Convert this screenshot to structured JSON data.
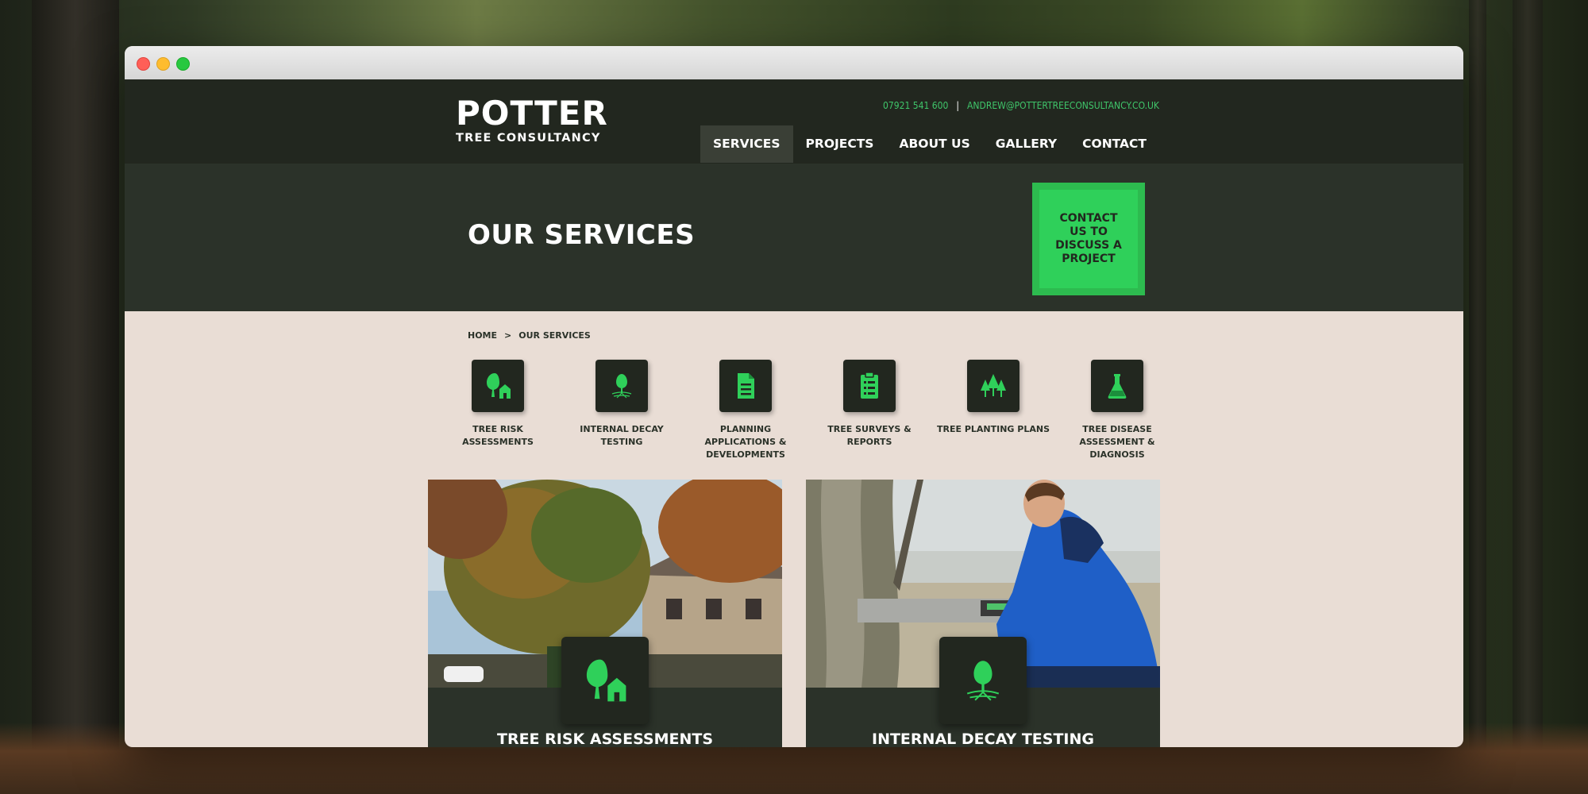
{
  "header": {
    "logo_main": "POTTER",
    "logo_sub": "TREE CONSULTANCY",
    "phone": "07921 541 600",
    "separator": "|",
    "email": "ANDREW@POTTERTREECONSULTANCY.CO.UK",
    "nav": [
      {
        "label": "SERVICES",
        "active": true
      },
      {
        "label": "PROJECTS",
        "active": false
      },
      {
        "label": "ABOUT US",
        "active": false
      },
      {
        "label": "GALLERY",
        "active": false
      },
      {
        "label": "CONTACT",
        "active": false
      }
    ]
  },
  "hero": {
    "title": "OUR SERVICES",
    "cta_label": "CONTACT US TO DISCUSS A PROJECT"
  },
  "breadcrumb": {
    "home": "HOME",
    "separator": ">",
    "current": "OUR SERVICES"
  },
  "services": [
    {
      "label": "TREE RISK ASSESSMENTS",
      "icon": "tree-house-icon"
    },
    {
      "label": "INTERNAL DECAY TESTING",
      "icon": "tree-roots-icon"
    },
    {
      "label": "PLANNING APPLICATIONS & DEVELOPMENTS",
      "icon": "document-icon"
    },
    {
      "label": "TREE SURVEYS & REPORTS",
      "icon": "clipboard-list-icon"
    },
    {
      "label": "TREE PLANTING PLANS",
      "icon": "trees-icon"
    },
    {
      "label": "TREE DISEASE ASSESSMENT & DIAGNOSIS",
      "icon": "flask-icon"
    }
  ],
  "cards": [
    {
      "title": "TREE RISK ASSESSMENTS",
      "icon": "tree-house-icon"
    },
    {
      "title": "INTERNAL DECAY TESTING",
      "icon": "tree-roots-icon"
    }
  ],
  "colors": {
    "brand_green": "#2fd05a",
    "header_dark": "#22271f",
    "hero_dark": "#2b3229",
    "page_bg": "#e9ddd5"
  }
}
